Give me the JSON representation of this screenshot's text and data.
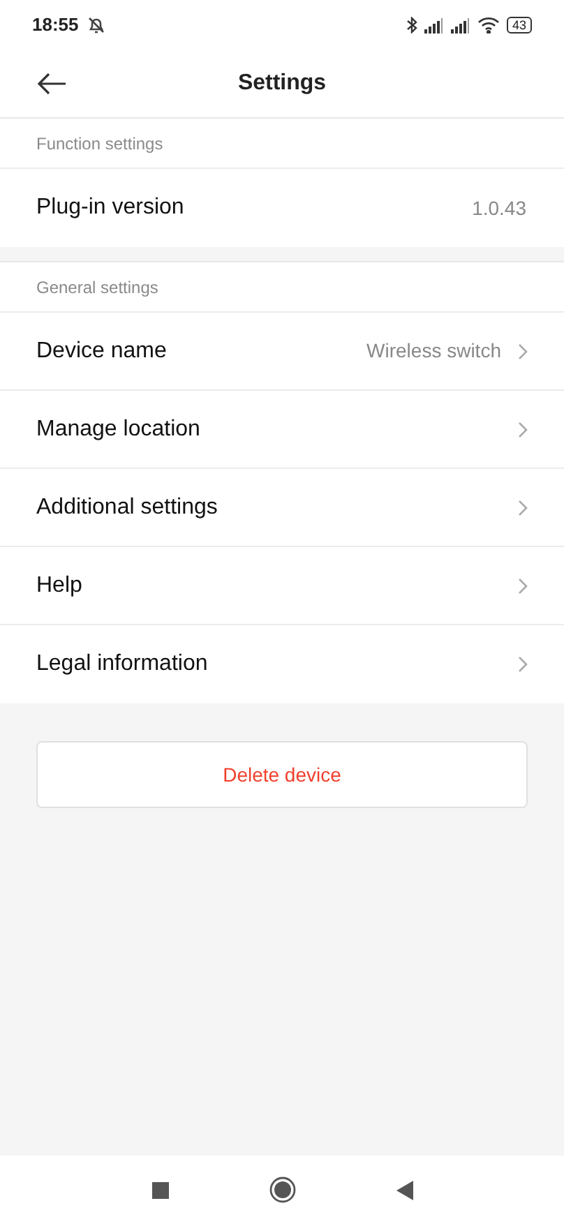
{
  "status_bar": {
    "time": "18:55",
    "battery": "43"
  },
  "header": {
    "title": "Settings"
  },
  "sections": [
    {
      "title": "Function settings",
      "rows": [
        {
          "label": "Plug-in version",
          "value": "1.0.43",
          "chevron": false
        }
      ]
    },
    {
      "title": "General settings",
      "rows": [
        {
          "label": "Device name",
          "value": "Wireless switch",
          "chevron": true
        },
        {
          "label": "Manage location",
          "chevron": true
        },
        {
          "label": "Additional settings",
          "chevron": true
        },
        {
          "label": "Help",
          "chevron": true
        },
        {
          "label": "Legal information",
          "chevron": true
        }
      ]
    }
  ],
  "delete_button": "Delete device"
}
